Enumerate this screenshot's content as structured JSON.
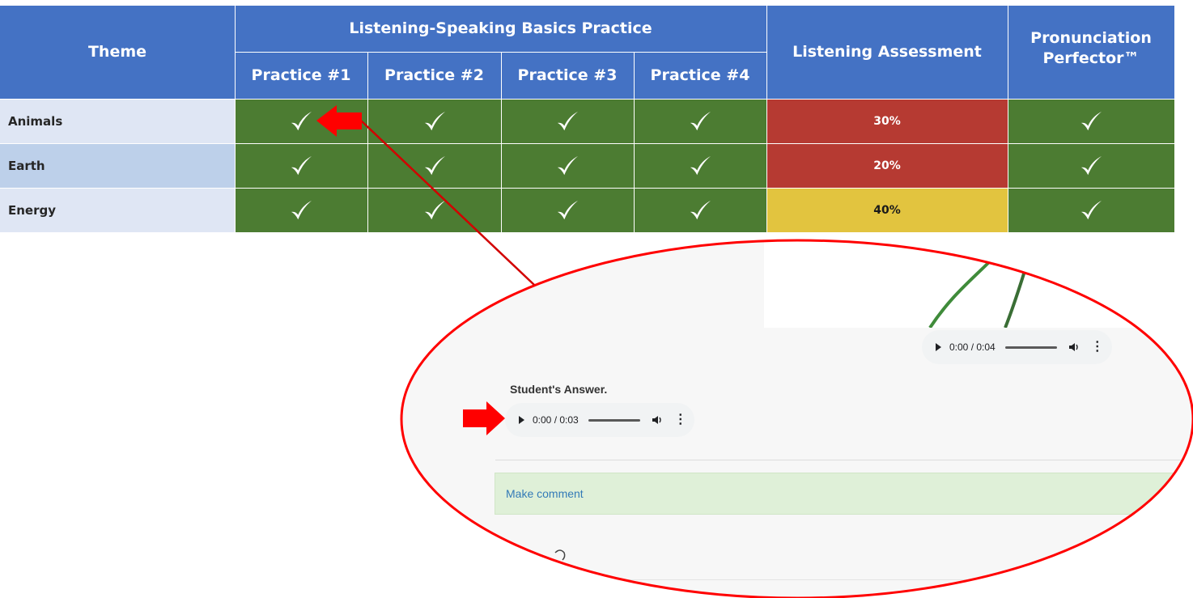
{
  "table": {
    "theme_header": "Theme",
    "practice_group_header": "Listening-Speaking Basics Practice",
    "practice_headers": [
      "Practice #1",
      "Practice #2",
      "Practice #3",
      "Practice #4"
    ],
    "assessment_header": "Listening Assessment",
    "pronunciation_header": "Pronunciation Perfector™",
    "rows": [
      {
        "theme": "Animals",
        "practices_done": [
          true,
          true,
          true,
          true
        ],
        "assessment": "30%",
        "pronunciation_done": true
      },
      {
        "theme": "Earth",
        "practices_done": [
          true,
          true,
          true,
          true
        ],
        "assessment": "20%",
        "pronunciation_done": true
      },
      {
        "theme": "Energy",
        "practices_done": [
          true,
          true,
          true,
          true
        ],
        "assessment": "40%",
        "pronunciation_done": true
      }
    ]
  },
  "zoom": {
    "question_audio": {
      "time": "0:00 / 0:04"
    },
    "answer_label": "Student's Answer.",
    "answer_audio": {
      "time": "0:00 / 0:03"
    },
    "comment_link": "Make comment"
  },
  "colors": {
    "header_blue": "#4472C4",
    "complete_green": "#4C7C32",
    "low_score_red": "#B63A32",
    "mid_score_yellow": "#E2C43F",
    "annotation_red": "#FF0000"
  },
  "icons": {
    "completed": "checkmark-icon",
    "audio_play": "play-icon",
    "audio_volume": "volume-icon",
    "audio_menu": "more-vert-icon",
    "callout": "red-arrow-icon"
  }
}
